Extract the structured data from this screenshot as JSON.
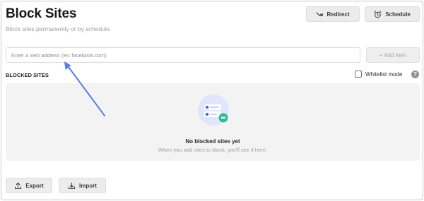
{
  "header": {
    "title": "Block Sites",
    "subtitle": "Block sites permanently or by schedule",
    "redirect_label": "Redirect",
    "schedule_label": "Schedule"
  },
  "add_site": {
    "placeholder": "Enter a web address (ex: facebook.com)",
    "value": "",
    "add_label": "+ Add Item"
  },
  "blocked": {
    "section_title": "BLOCKED SITES",
    "whitelist_label": "Whitelist mode",
    "whitelist_checked": false,
    "help_glyph": "?",
    "empty_title": "No blocked sites yet",
    "empty_desc": "When you add sites to block, you'll see it here."
  },
  "footer": {
    "export_label": "Export",
    "import_label": "Import"
  },
  "icons": {
    "redirect": "redirect-arrow-icon",
    "schedule": "alarm-clock-icon",
    "export": "upload-icon",
    "import": "download-icon",
    "illustration": "blocked-list-illustration-icon",
    "annotation": "annotation-arrow-icon"
  },
  "colors": {
    "annotation_arrow": "#5b7be6",
    "illustration_bg": "#dfe6fb",
    "illustration_accent": "#2fb98f",
    "primary_blue": "#3a6fe0"
  }
}
